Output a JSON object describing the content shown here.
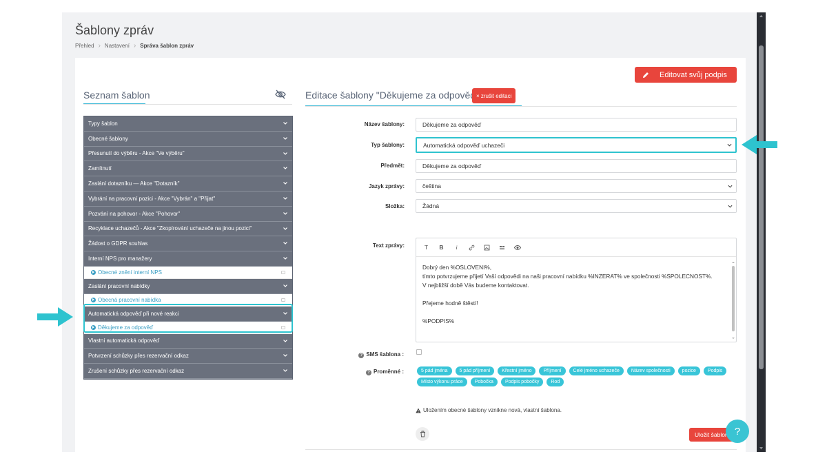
{
  "header": {
    "title": "Šablony zpráv",
    "breadcrumb": [
      "Přehled",
      "Nastavení",
      "Správa šablon zpráv"
    ]
  },
  "left": {
    "title": "Seznam šablon",
    "groups": [
      {
        "label": "Typy šablon"
      },
      {
        "label": "Obecné šablony"
      },
      {
        "label": "Přesunutí do výběru - Akce \"Ve výběru\""
      },
      {
        "label": "Zamítnutí"
      },
      {
        "label": "Zaslání dotazníku — Akce \"Dotazník\""
      },
      {
        "label": "Vybrání na pracovní pozici - Akce \"Vybrán\" a \"Přijat\""
      },
      {
        "label": "Pozvání na pohovor - Akce \"Pohovor\""
      },
      {
        "label": "Recyklace uchazečů - Akce \"Zkopírování uchazeče na jinou pozici\""
      },
      {
        "label": "Žádost o GDPR souhlas"
      },
      {
        "label": "Interní NPS pro manažery",
        "sub": "Obecné znění interní NPS"
      },
      {
        "label": "Zaslání pracovní nabídky",
        "sub": "Obecná pracovní nabídka"
      },
      {
        "label": "Automatická odpověď při nové reakci",
        "sub": "Děkujeme za odpověď"
      },
      {
        "label": "Vlastní automatická odpověď"
      },
      {
        "label": "Potvrzení schůzky přes rezervační odkaz"
      },
      {
        "label": "Zrušení schůzky přes rezervační odkaz"
      }
    ]
  },
  "right": {
    "edit_signature": "Editovat svůj podpis",
    "title": "Editace šablony \"Děkujeme za odpověď\"",
    "cancel": "× zrušit editaci",
    "labels": {
      "name": "Název šablony:",
      "type": "Typ šablony:",
      "subject": "Předmět:",
      "language": "Jazyk zprávy:",
      "folder": "Složka:",
      "text": "Text zprávy:",
      "sms": "SMS šablona :",
      "variables": "Proměnné :"
    },
    "values": {
      "name": "Děkujeme za odpověď",
      "type": "Automatická odpověď uchazeči",
      "subject": "Děkujeme za odpověď",
      "language": "čeština",
      "folder": "Žádná"
    },
    "editor_tools": [
      "T",
      "B",
      "i"
    ],
    "editor_lines": [
      "Dobrý den %OSLOVENI%,",
      "tímto potvrzujeme přijetí Vaší odpovědi na naši pracovní nabídku %INZERAT% ve společnosti %SPOLECNOST%.",
      "V nejbližší době Vás budeme kontaktovat.",
      "",
      "Přejeme hodně štěstí!",
      "",
      "%PODPIS%"
    ],
    "variables": [
      "5 pád jména",
      "5 pád příjmení",
      "Křestní jméno",
      "Příjmení",
      "Celé jméno uchazeče",
      "Název společnosti",
      "pozice",
      "Podpis",
      "Místo výkonu práce",
      "Pobočka",
      "Podpis pobočky",
      "Rod"
    ],
    "warning": "Uložením obecné šablony vznikne nová, vlastní šablona.",
    "save": "Uložit šablonu",
    "help": "?"
  },
  "colors": {
    "accent": "#2ec3cf",
    "danger": "#e8453c",
    "accordion_header": "#6a707d",
    "link": "#3a9ec3"
  }
}
